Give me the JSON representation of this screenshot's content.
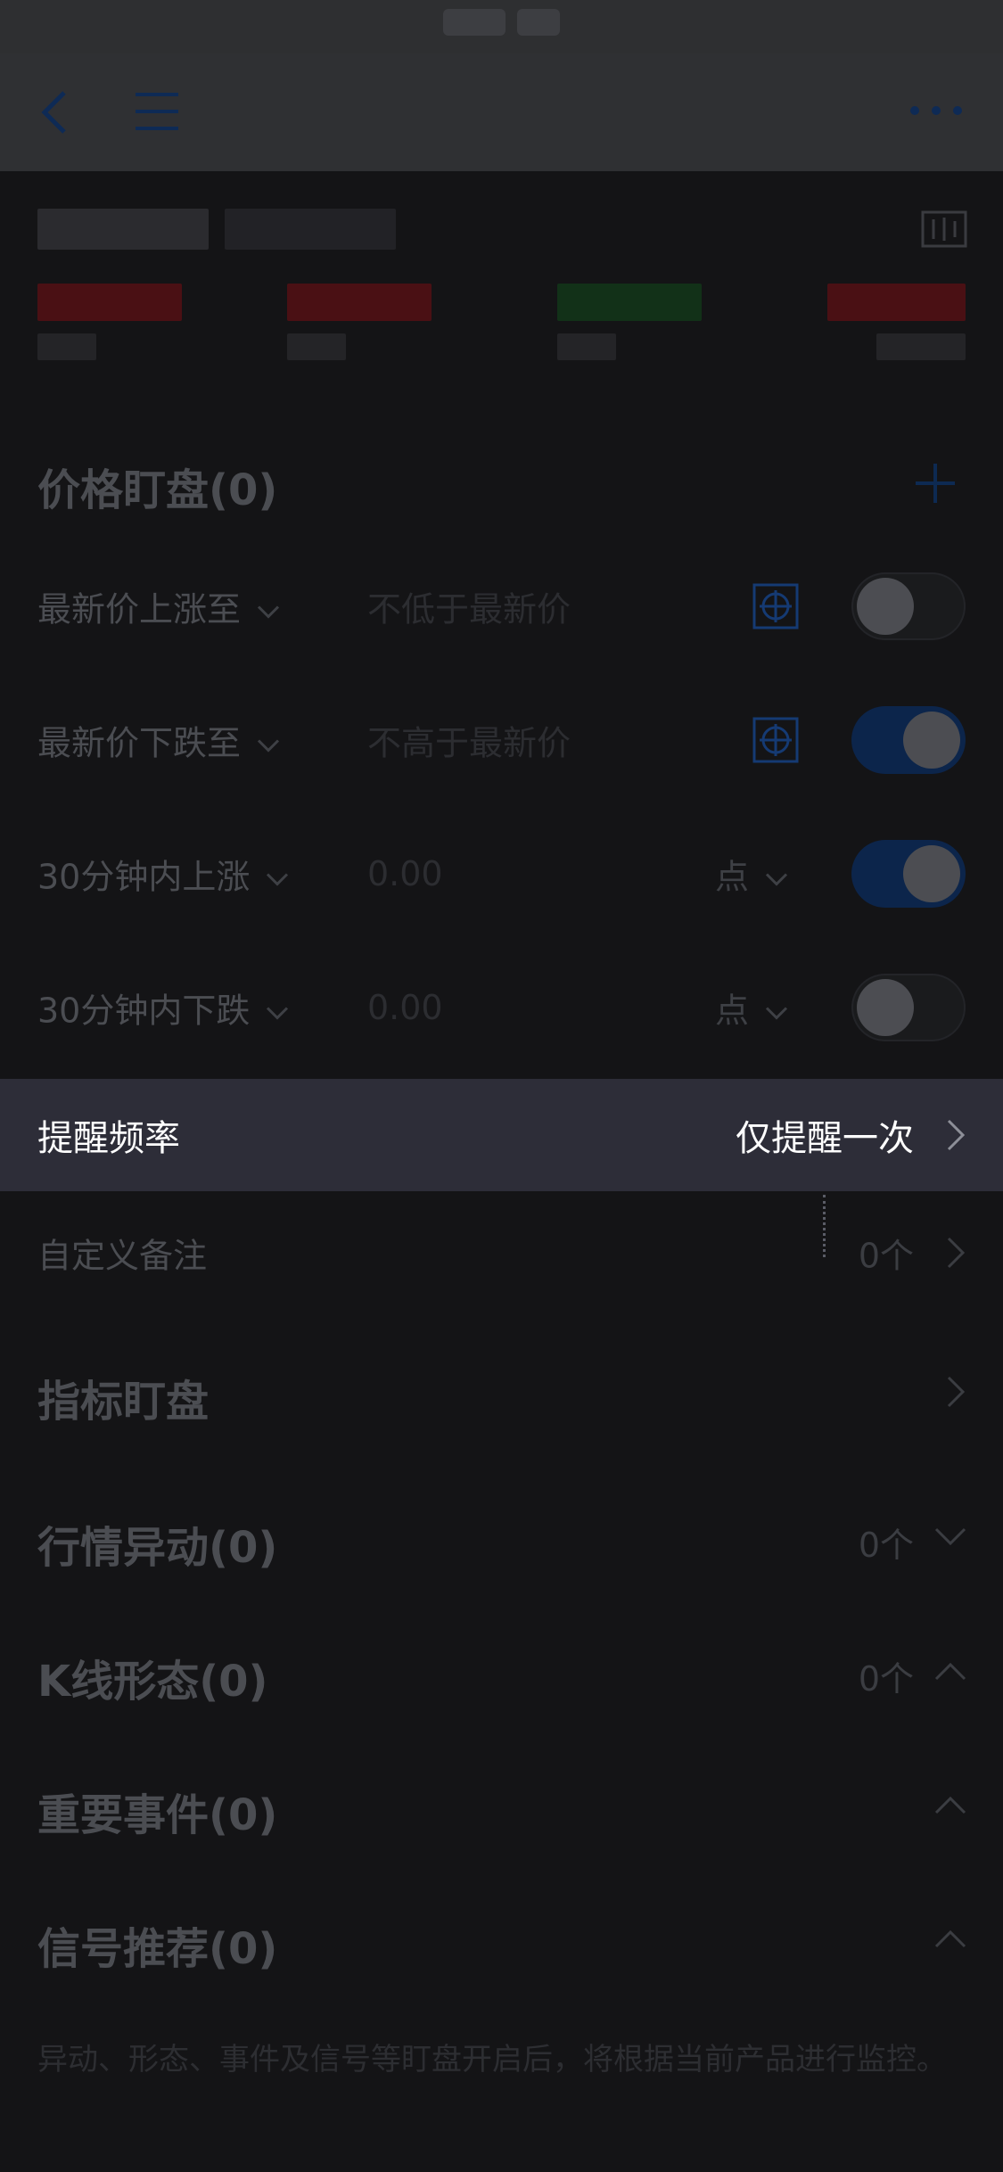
{
  "header": {
    "back_icon": "chevron-left-icon",
    "menu_icon": "menu-icon",
    "more_icon": "more-horizontal-icon"
  },
  "quote": {
    "chart_icon": "candlestick-chart-icon"
  },
  "price_watch": {
    "title": "价格盯盘(0)",
    "add_icon": "plus-icon",
    "rows": [
      {
        "label": "最新价上涨至",
        "placeholder": "不低于最新价",
        "toggle": "off"
      },
      {
        "label": "最新价下跌至",
        "placeholder": "不高于最新价",
        "toggle": "on"
      },
      {
        "label": "30分钟内上涨",
        "placeholder": "0.00",
        "unit": "点",
        "toggle": "on"
      },
      {
        "label": "30分钟内下跌",
        "placeholder": "0.00",
        "unit": "点",
        "toggle": "off"
      }
    ]
  },
  "alert_frequency": {
    "label": "提醒频率",
    "value": "仅提醒一次"
  },
  "custom_note": {
    "label": "自定义备注",
    "count": "0个"
  },
  "indicator_watch": {
    "title": "指标盯盘"
  },
  "market_movement": {
    "title": "行情异动(0)",
    "count": "0个"
  },
  "kline_pattern": {
    "title": "K线形态(0)",
    "count": "0个"
  },
  "important_events": {
    "title": "重要事件(0)"
  },
  "signal_recommend": {
    "title": "信号推荐(0)"
  },
  "footer": {
    "text": "异动、形态、事件及信号等盯盘开启后，将根据当前产品进行监控。"
  },
  "colors": {
    "overlay_bg": "#141416",
    "highlight_bg": "#2d2d38",
    "toggle_on": "#0c254b",
    "accent_blue": "#153a73"
  }
}
